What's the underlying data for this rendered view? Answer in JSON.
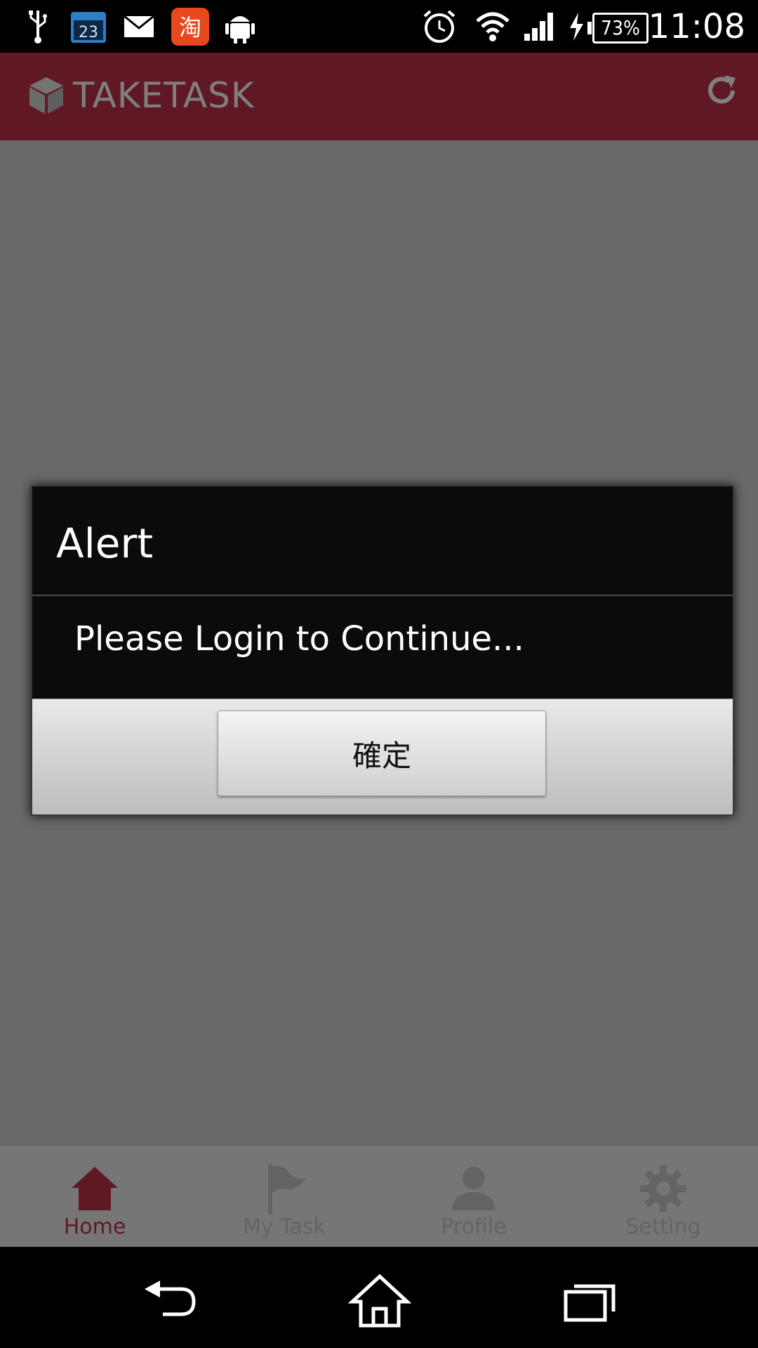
{
  "status_bar": {
    "time": "11:08",
    "battery": "73%",
    "calendar_day": "23",
    "icons": [
      "usb-icon",
      "calendar-icon",
      "mail-icon",
      "taobao-icon",
      "android-icon",
      "alarm-icon",
      "wifi-icon",
      "signal-icon",
      "charging-icon"
    ]
  },
  "app_bar": {
    "title": "TAKETASK",
    "logo_icon": "cube-icon",
    "action_icon": "refresh-icon",
    "color": "#c2314a"
  },
  "dialog": {
    "title": "Alert",
    "message": "Please Login to Continue...",
    "button_label": "確定"
  },
  "tabs": [
    {
      "label": "Home",
      "icon": "home-icon",
      "active": true
    },
    {
      "label": "My Task",
      "icon": "flag-icon",
      "active": false
    },
    {
      "label": "Profile",
      "icon": "person-icon",
      "active": false
    },
    {
      "label": "Setting",
      "icon": "gear-icon",
      "active": false
    }
  ],
  "nav_bar": {
    "icons": [
      "back-icon",
      "home-icon",
      "recents-icon"
    ]
  }
}
